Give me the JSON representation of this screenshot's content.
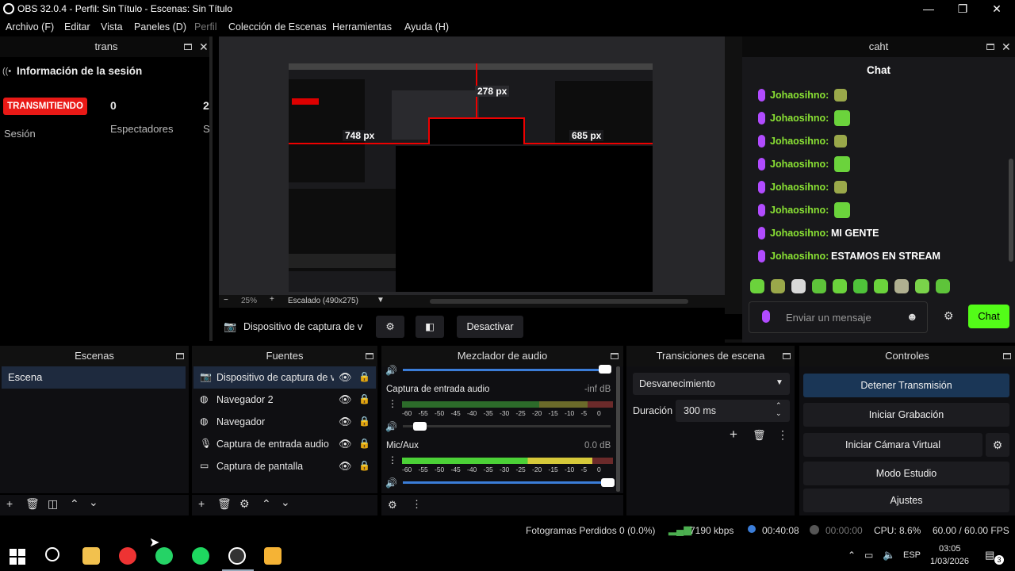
{
  "window": {
    "title": "OBS 32.0.4 - Perfil: Sin Título - Escenas: Sin Título"
  },
  "menu": [
    "Archivo (F)",
    "Editar",
    "Vista",
    "Paneles (D)",
    "Perfil",
    "Colección de Escenas",
    "Herramientas",
    "Ayuda (H)"
  ],
  "trans_dock": {
    "title": "trans",
    "header": "Información de la sesión",
    "live_badge": "TRANSMITIENDO",
    "viewers_value": "0",
    "second_value": "2",
    "session_label": "Sesión",
    "viewers_label": "Espectadores",
    "cut_label": "S"
  },
  "preview": {
    "zoom": "25%",
    "scaling": "Escalado (490x275)",
    "measure_top": "278 px",
    "measure_left": "748 px",
    "measure_right": "685 px"
  },
  "source_bar": {
    "source_name": "Dispositivo de captura de v",
    "deactivate_label": "Desactivar"
  },
  "chat_dock": {
    "title": "caht",
    "header": "Chat",
    "messages": [
      {
        "user": "Johaosihno:",
        "text": ""
      },
      {
        "user": "Johaosihno:",
        "text": ""
      },
      {
        "user": "Johaosihno:",
        "text": ""
      },
      {
        "user": "Johaosihno:",
        "text": ""
      },
      {
        "user": "Johaosihno:",
        "text": ""
      },
      {
        "user": "Johaosihno:",
        "text": ""
      },
      {
        "user": "Johaosihno:",
        "text": "MI GENTE"
      },
      {
        "user": "Johaosihno:",
        "text": "ESTAMOS EN STREAM"
      }
    ],
    "input_placeholder": "Enviar un mensaje",
    "send_label": "Chat",
    "accent": "#53fc18"
  },
  "scenes": {
    "title": "Escenas",
    "items": [
      "Escena"
    ]
  },
  "sources": {
    "title": "Fuentes",
    "items": [
      "Dispositivo de captura de v",
      "Navegador 2",
      "Navegador",
      "Captura de entrada audio",
      "Captura de pantalla"
    ]
  },
  "mixer": {
    "title": "Mezclador de audio",
    "channels": [
      {
        "name": "Captura de entrada audio",
        "level": "-inf dB",
        "volume": 0.05
      },
      {
        "name": "Mic/Aux",
        "level": "0.0 dB",
        "volume": 1.0
      }
    ],
    "scale": [
      "-60",
      "-55",
      "-50",
      "-45",
      "-40",
      "-35",
      "-30",
      "-25",
      "-20",
      "-15",
      "-10",
      "-5",
      "0"
    ]
  },
  "transitions": {
    "title": "Transiciones de escena",
    "selected": "Desvanecimiento",
    "duration_label": "Duración",
    "duration_value": "300 ms"
  },
  "controls": {
    "title": "Controles",
    "buttons": [
      "Detener Transmisión",
      "Iniciar Grabación",
      "Iniciar Cámara Virtual",
      "Modo Estudio",
      "Ajustes"
    ]
  },
  "status": {
    "dropped": "Fotogramas Perdidos 0 (0.0%)",
    "bitrate": "7190 kbps",
    "live_time": "00:40:08",
    "rec_time": "00:00:00",
    "cpu": "CPU: 8.6%",
    "fps": "60.00 / 60.00 FPS"
  },
  "taskbar": {
    "lang": "ESP",
    "time": "03:05",
    "date": "1/03/2026",
    "notif_count": "3"
  }
}
